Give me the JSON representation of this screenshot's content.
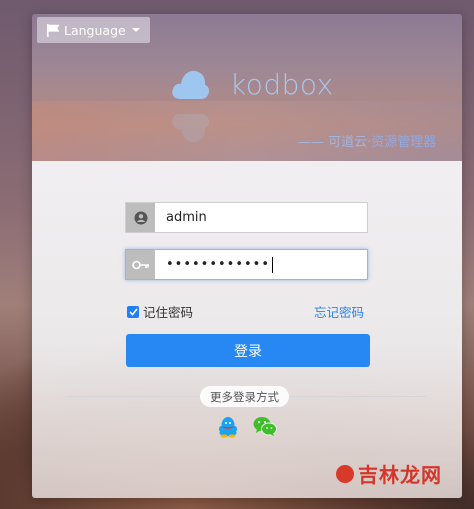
{
  "language_button": {
    "label": "Language"
  },
  "brand": {
    "name": "kodbox",
    "slogan_prefix": "—— 可道云",
    "slogan_suffix": "·资源管理器"
  },
  "form": {
    "username": "admin",
    "password_mask": "••••••••••••",
    "remember_label": "记住密码",
    "remember_checked": true,
    "forgot_label": "忘记密码",
    "login_label": "登录"
  },
  "social": {
    "more_label": "更多登录方式",
    "icons": [
      "qq-icon",
      "wechat-icon"
    ]
  },
  "watermark": {
    "text": "吉林龙网"
  },
  "colors": {
    "accent": "#2788f3",
    "link": "#2c84e6",
    "brand_text": "#a6c8f0",
    "qq": "#1aa3f0",
    "wechat": "#3fbe2a"
  }
}
